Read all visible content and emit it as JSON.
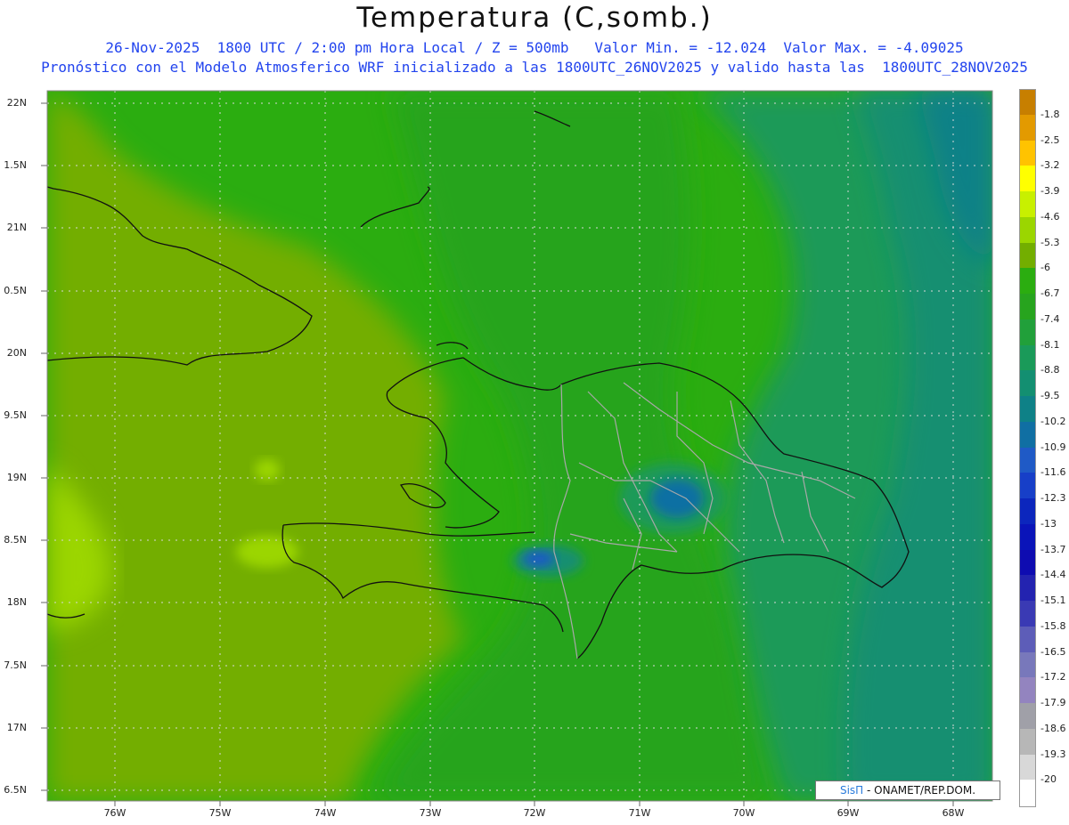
{
  "title": "Temperatura (C,somb.)",
  "subtitle_1": "26-Nov-2025  1800 UTC / 2:00 pm Hora Local / Z = 500mb   Valor Min. = -12.024  Valor Max. = -4.09025",
  "subtitle_2": "Pronóstico con el Modelo Atmosferico WRF inicializado a las 1800UTC_26NOV2025 y valido hasta las  1800UTC_28NOV2025",
  "credit": {
    "brand": "SisΠ",
    "text": " - ONAMET/REP.DOM."
  },
  "axes": {
    "lat_labels": [
      "22N",
      "1.5N",
      "21N",
      "0.5N",
      "20N",
      "9.5N",
      "19N",
      "8.5N",
      "18N",
      "7.5N",
      "17N",
      "6.5N"
    ],
    "lon_labels": [
      "76W",
      "75W",
      "74W",
      "73W",
      "72W",
      "71W",
      "70W",
      "69W",
      "68W"
    ],
    "lat_range": [
      16.5,
      22.0
    ],
    "lon_range": [
      -76.65,
      -67.6
    ],
    "grid": "dotted"
  },
  "colorbar": {
    "labels": [
      "-1.8",
      "-2.5",
      "-3.2",
      "-3.9",
      "-4.6",
      "-5.3",
      "-6",
      "-6.7",
      "-7.4",
      "-8.1",
      "-8.8",
      "-9.5",
      "-10.2",
      "-10.9",
      "-11.6",
      "-12.3",
      "-13",
      "-13.7",
      "-14.4",
      "-15.1",
      "-15.8",
      "-16.5",
      "-17.2",
      "-17.9",
      "-18.6",
      "-19.3",
      "-20"
    ],
    "colors": [
      "#c77f00",
      "#e39a00",
      "#ffc300",
      "#ffff00",
      "#c8f000",
      "#9bd600",
      "#73ae00",
      "#2bad10",
      "#27a41e",
      "#21a03a",
      "#1a9a59",
      "#138f71",
      "#0e8187",
      "#106fa3",
      "#1f5ac6",
      "#173fc8",
      "#0c26bd",
      "#0a14b9",
      "#0e0cb1",
      "#2323b0",
      "#3a3ab4",
      "#5d5db8",
      "#7878bb",
      "#9384bf",
      "#a0a0a8",
      "#b7b7b7",
      "#d8d8d8",
      "#ffffff"
    ]
  },
  "field": {
    "units": "C",
    "level": "500mb",
    "min": -12.024,
    "max": -4.09025
  }
}
